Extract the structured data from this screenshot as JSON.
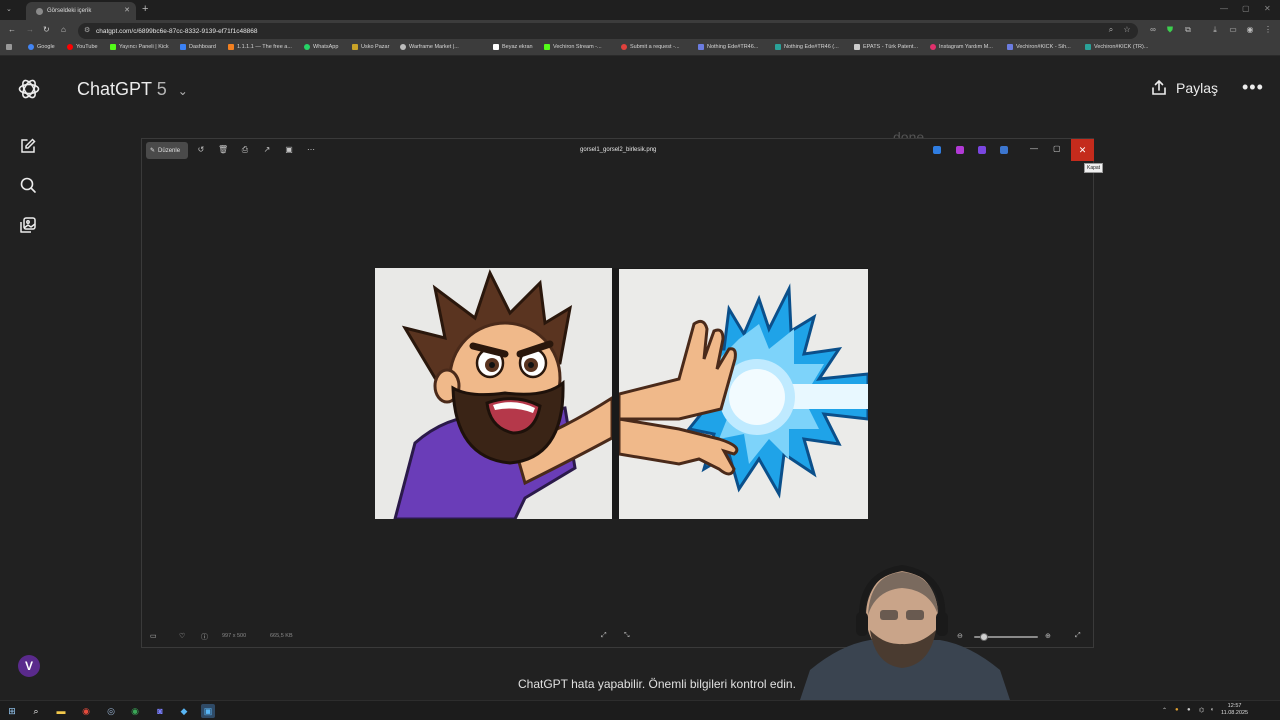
{
  "browser": {
    "tab_title": "Görseldeki içerik",
    "url": "chatgpt.com/c/6899bc6e-87cc-8332-9139-ef71f1c48868",
    "bookmarks": [
      {
        "label": "Google",
        "color": "#4285f4"
      },
      {
        "label": "YouTube",
        "color": "#ff0000"
      },
      {
        "label": "Yayıncı Paneli | Kick",
        "color": "#53fc18"
      },
      {
        "label": "Dashboard",
        "color": "#3b82f6"
      },
      {
        "label": "1.1.1.1 — The free a...",
        "color": "#f38020"
      },
      {
        "label": "WhatsApp",
        "color": "#25d366"
      },
      {
        "label": "Usko Pazar",
        "color": "#c9a227"
      },
      {
        "label": "Warframe Market |...",
        "color": "#bbbbbb"
      },
      {
        "label": "Beyaz ekran",
        "color": "#ffffff"
      },
      {
        "label": "Vechiron Stream -...",
        "color": "#53fc18"
      },
      {
        "label": "Submit a request -...",
        "color": "#e0413c"
      },
      {
        "label": "Nothing Ede#TR46...",
        "color": "#6b7ce0"
      },
      {
        "label": "Nothing Ede#TR46 (...",
        "color": "#2aa198"
      },
      {
        "label": "EPATS - Türk Patent...",
        "color": "#cccccc"
      },
      {
        "label": "Instagram Yardım M...",
        "color": "#e1306c"
      },
      {
        "label": "Vechiron#KICK - Sih...",
        "color": "#6b7ce0"
      },
      {
        "label": "Vechiron#KICK (TR)...",
        "color": "#2aa198"
      }
    ]
  },
  "chatgpt": {
    "model_name": "ChatGPT",
    "model_version": "5",
    "share_label": "Paylaş",
    "behind_text": "done",
    "footer_note": "ChatGPT hata yapabilir. Önemli bilgileri kontrol edin.",
    "avatar_letter": "V"
  },
  "viewer": {
    "edit_label": "Düzenle",
    "filename": "gorsel1_gorsel2_birlesik.png",
    "close_tooltip": "Kapat",
    "dimensions": "997 x 500",
    "file_size": "665,5 KB",
    "zoom_level_fraction": 0.15
  },
  "taskbar": {
    "time": "12:57",
    "date": "11.08.2025"
  }
}
